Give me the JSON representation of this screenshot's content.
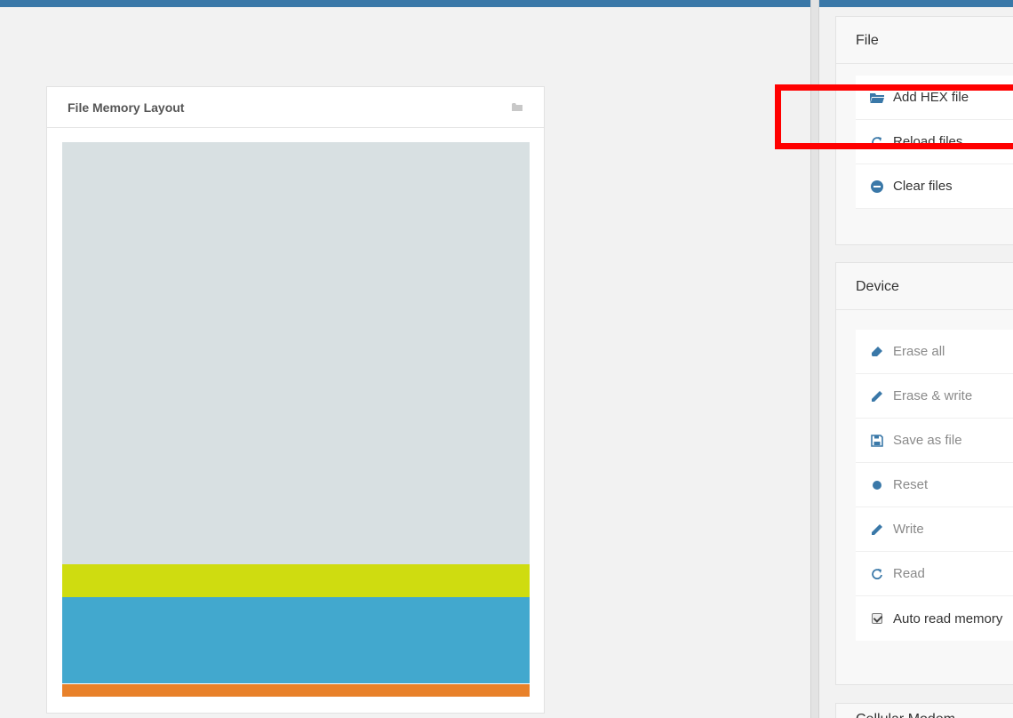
{
  "colors": {
    "accent": "#3a78a8",
    "highlight": "#ff0000",
    "region_unused": "#d8e0e2",
    "region_1": "#cfdc10",
    "region_2": "#42a8ce",
    "region_3": "#e8812a"
  },
  "memory_panel": {
    "title": "File Memory Layout",
    "icon": "folder-icon"
  },
  "file_section": {
    "title": "File",
    "buttons": [
      {
        "label": "Add HEX file",
        "icon": "folder-open-icon",
        "enabled": true
      },
      {
        "label": "Reload files",
        "icon": "reload-icon",
        "enabled": true
      },
      {
        "label": "Clear files",
        "icon": "minus-circle-icon",
        "enabled": true
      }
    ]
  },
  "device_section": {
    "title": "Device",
    "buttons": [
      {
        "label": "Erase all",
        "icon": "eraser-icon",
        "enabled": false
      },
      {
        "label": "Erase & write",
        "icon": "pencil-icon",
        "enabled": false
      },
      {
        "label": "Save as file",
        "icon": "save-icon",
        "enabled": false
      },
      {
        "label": "Reset",
        "icon": "dot-icon",
        "enabled": false
      },
      {
        "label": "Write",
        "icon": "pencil-icon",
        "enabled": false
      },
      {
        "label": "Read",
        "icon": "reload-icon",
        "enabled": false
      }
    ],
    "auto_read": {
      "label": "Auto read memory",
      "checked": true
    }
  },
  "cellular_section": {
    "title": "Cellular Modem"
  }
}
